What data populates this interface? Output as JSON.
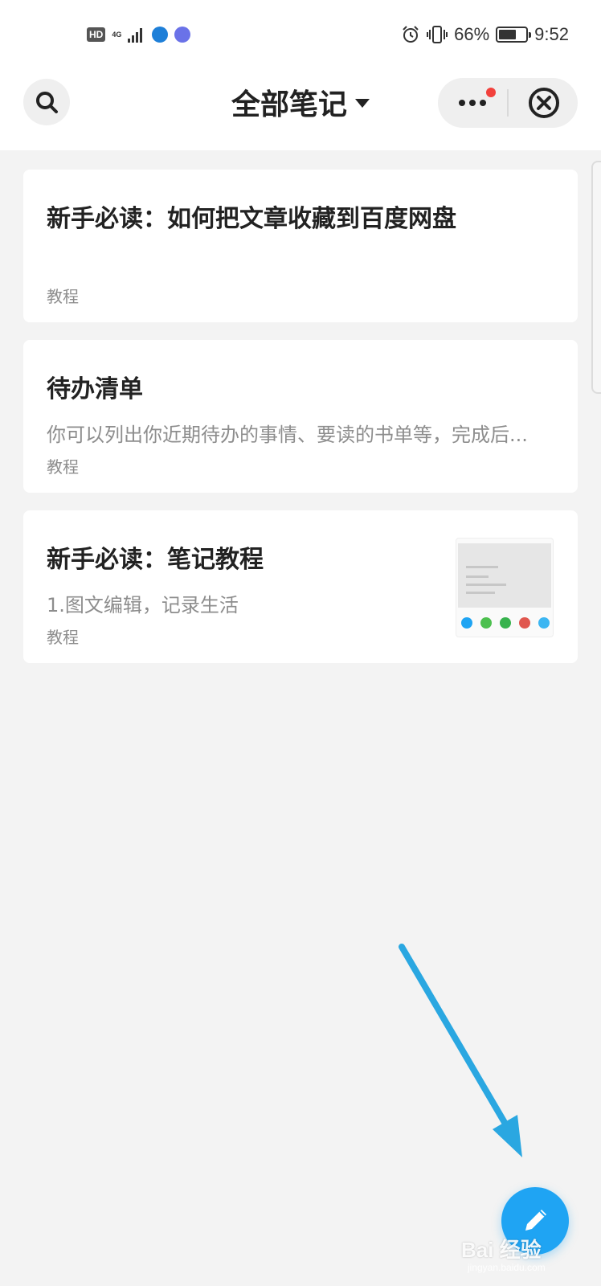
{
  "status_bar": {
    "hd": "HD",
    "network": "4G",
    "battery_percent": "66%",
    "battery_level": 0.66,
    "time": "9:52",
    "icons": [
      "hd-icon",
      "signal-icon",
      "globe-app-icon",
      "music-app-icon",
      "alarm-icon",
      "vibrate-icon",
      "battery-icon"
    ]
  },
  "header": {
    "title": "全部笔记",
    "icons": [
      "search-icon",
      "caret-down-icon",
      "more-icon",
      "close-icon"
    ]
  },
  "notes": [
    {
      "title": "新手必读：如何把文章收藏到百度网盘",
      "summary": "",
      "tag": "教程"
    },
    {
      "title": "待办清单",
      "summary": "你可以列出你近期待办的事情、要读的书单等，完成后...",
      "tag": "教程"
    },
    {
      "title": "新手必读：笔记教程",
      "summary": "1.图文编辑，记录生活",
      "tag": "教程",
      "has_thumbnail": true
    }
  ],
  "fab": {
    "icon": "pencil-icon"
  },
  "watermark": {
    "text": "Bai 经验",
    "sub": "jingyan.baidu.com"
  },
  "colors": {
    "accent": "#1fa4f3",
    "arrow": "#2aa7e1",
    "badge_red": "#f2413c",
    "background": "#f3f3f3"
  }
}
